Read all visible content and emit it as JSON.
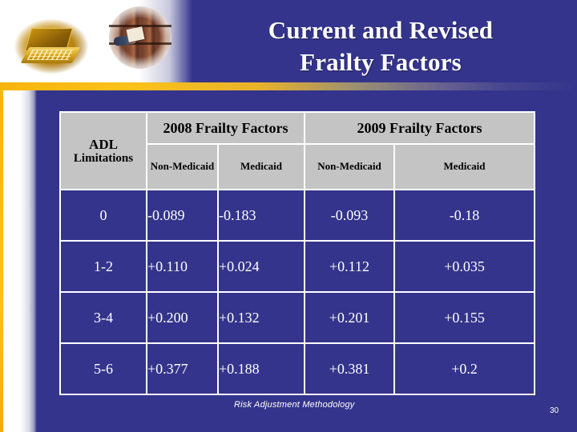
{
  "slide": {
    "title_line1": "Current and Revised",
    "title_line2": "Frailty Factors",
    "background_color": "#34348c",
    "accent_gold": "#fcc21a",
    "header_cell_color": "#c4c4c4"
  },
  "decorations": {
    "image_laptop": "golden-laptop-photo",
    "image_files": "records-filing-photo"
  },
  "table": {
    "header": {
      "adl_label_top": "ADL",
      "adl_label_bottom": "Limitations",
      "group_2008": "2008 Frailty Factors",
      "group_2009": "2009 Frailty Factors",
      "sub_2008_non_medicaid": "Non-Medicaid",
      "sub_2008_medicaid": "Medicaid",
      "sub_2009_non_medicaid": "Non-Medicaid",
      "sub_2009_medicaid": "Medicaid"
    },
    "rows": [
      {
        "adl": "0",
        "f2008_non_medicaid": "-0.089",
        "f2008_medicaid": "-0.183",
        "f2009_non_medicaid": "-0.093",
        "f2009_medicaid": "-0.18"
      },
      {
        "adl": "1-2",
        "f2008_non_medicaid": "+0.110",
        "f2008_medicaid": "+0.024",
        "f2009_non_medicaid": "+0.112",
        "f2009_medicaid": "+0.035"
      },
      {
        "adl": "3-4",
        "f2008_non_medicaid": "+0.200",
        "f2008_medicaid": "+0.132",
        "f2009_non_medicaid": "+0.201",
        "f2009_medicaid": "+0.155"
      },
      {
        "adl": "5-6",
        "f2008_non_medicaid": "+0.377",
        "f2008_medicaid": "+0.188",
        "f2009_non_medicaid": "+0.381",
        "f2009_medicaid": "+0.2"
      }
    ]
  },
  "footer": {
    "note": "Risk Adjustment Methodology",
    "page_number": "30"
  }
}
